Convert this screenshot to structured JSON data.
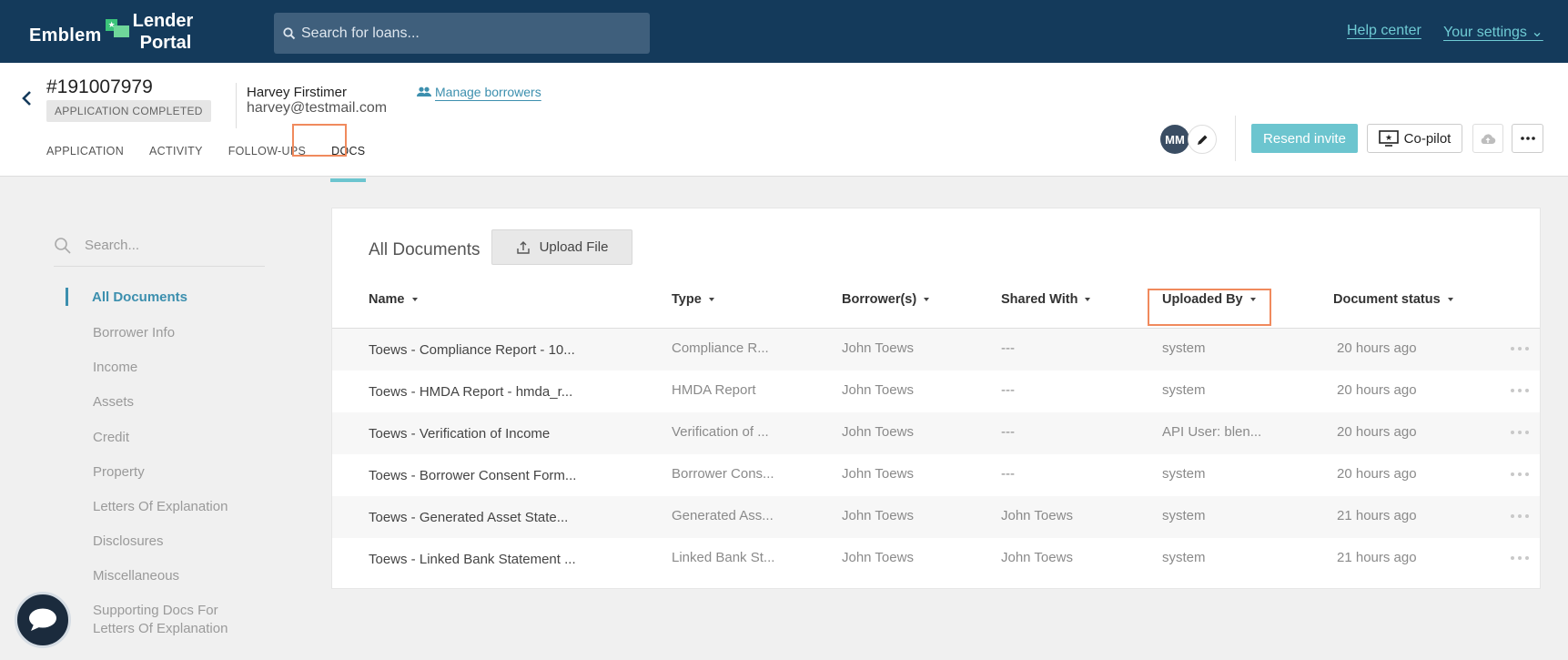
{
  "brand": {
    "emblem": "Emblem",
    "line1": "Lender",
    "line2": "Portal"
  },
  "topbar": {
    "search_placeholder": "Search for loans...",
    "help_center": "Help center",
    "your_settings": "Your settings ⌄"
  },
  "loan": {
    "id": "#191007979",
    "status": "APPLICATION COMPLETED",
    "borrower_name": "Harvey Firstimer",
    "borrower_email": "harvey@testmail.com",
    "manage_borrowers": "Manage borrowers"
  },
  "tabs": [
    {
      "label": "APPLICATION"
    },
    {
      "label": "ACTIVITY"
    },
    {
      "label": "FOLLOW-UPS"
    },
    {
      "label": "DOCS",
      "active": true
    }
  ],
  "actions": {
    "avatar_initials": "MM",
    "resend_invite": "Resend invite",
    "copilot": "Co-pilot"
  },
  "sidebar": {
    "search_placeholder": "Search...",
    "items": [
      {
        "label": "All Documents",
        "active": true
      },
      {
        "label": "Borrower Info"
      },
      {
        "label": "Income"
      },
      {
        "label": "Assets"
      },
      {
        "label": "Credit"
      },
      {
        "label": "Property"
      },
      {
        "label": "Letters Of Explanation"
      },
      {
        "label": "Disclosures"
      },
      {
        "label": "Miscellaneous"
      },
      {
        "label": "Supporting Docs For"
      },
      {
        "label": "Letters Of Explanation"
      }
    ]
  },
  "documents": {
    "title": "All Documents",
    "upload_label": "Upload File",
    "columns": [
      "Name",
      "Type",
      "Borrower(s)",
      "Shared With",
      "Uploaded By",
      "Document status"
    ],
    "rows": [
      {
        "name": "Toews - Compliance Report - 10...",
        "type": "Compliance R...",
        "borrower": "John Toews",
        "shared": "---",
        "uploaded": "system",
        "status": "20 hours ago"
      },
      {
        "name": "Toews - HMDA Report - hmda_r...",
        "type": "HMDA Report",
        "borrower": "John Toews",
        "shared": "---",
        "uploaded": "system",
        "status": "20 hours ago"
      },
      {
        "name": "Toews - Verification of Income",
        "type": "Verification of ...",
        "borrower": "John Toews",
        "shared": "---",
        "uploaded": "API User: blen...",
        "status": "20 hours ago"
      },
      {
        "name": "Toews - Borrower Consent Form...",
        "type": "Borrower Cons...",
        "borrower": "John Toews",
        "shared": "---",
        "uploaded": "system",
        "status": "20 hours ago"
      },
      {
        "name": "Toews - Generated Asset State...",
        "type": "Generated Ass...",
        "borrower": "John Toews",
        "shared": "John Toews",
        "uploaded": "system",
        "status": "21 hours ago"
      },
      {
        "name": "Toews - Linked Bank Statement ...",
        "type": "Linked Bank St...",
        "borrower": "John Toews",
        "shared": "John Toews",
        "uploaded": "system",
        "status": "21 hours ago"
      }
    ]
  },
  "colors": {
    "topbar": "#143a5b",
    "accent_teal": "#6cc5cf",
    "link_blue": "#3c8fae",
    "highlight_orange": "#f08a5d"
  }
}
